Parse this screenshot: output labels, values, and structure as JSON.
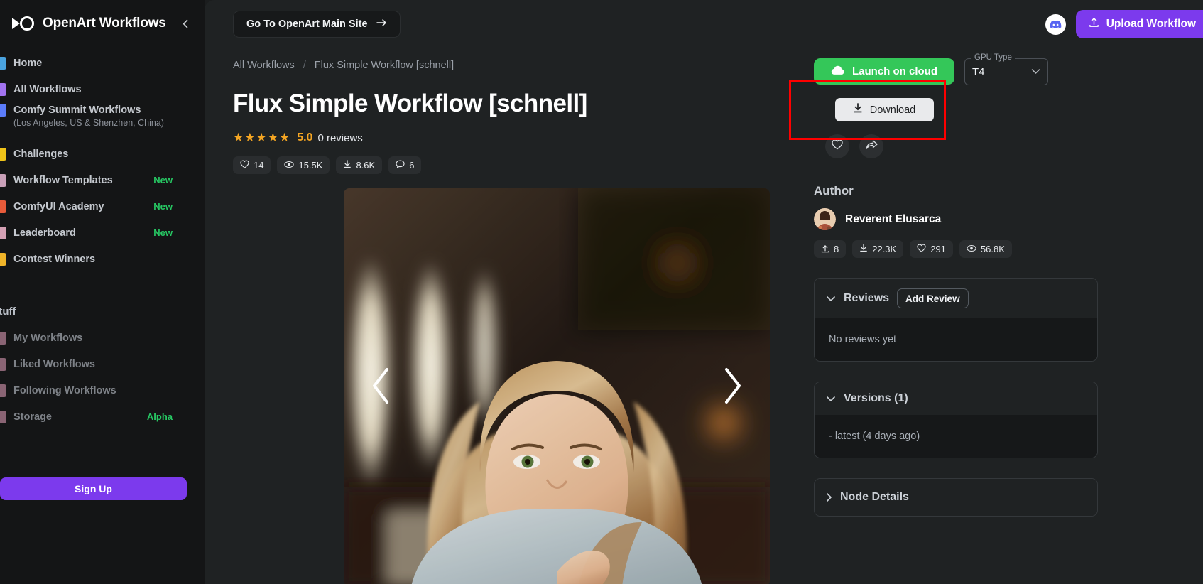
{
  "sidebar": {
    "brand": "OpenArt Workflows",
    "collapse_icon": "chevron-left-icon",
    "items": [
      {
        "label": "Home",
        "badge": "",
        "sub": "",
        "color": "#4aa3df"
      },
      {
        "label": "All Workflows",
        "badge": "",
        "sub": "",
        "color": "#a273f0"
      },
      {
        "label": "Comfy Summit Workflows",
        "sub": "(Los Angeles, US & Shenzhen, China)",
        "badge": "",
        "color": "#5b7cfa"
      },
      {
        "label": "Challenges",
        "badge": "",
        "sub": "",
        "color": "#f0c419"
      },
      {
        "label": "Workflow Templates",
        "badge": "New",
        "sub": "",
        "color": "#c9a0b8"
      },
      {
        "label": "ComfyUI Academy",
        "badge": "New",
        "sub": "",
        "color": "#e85b3a"
      },
      {
        "label": "Leaderboard",
        "badge": "New",
        "sub": "",
        "color": "#d4a0b4"
      },
      {
        "label": "Contest Winners",
        "badge": "",
        "sub": "",
        "color": "#f0b429"
      }
    ],
    "section_label": "stuff",
    "user_items": [
      {
        "label": "My Workflows",
        "badge": "",
        "color": "#b07a8e"
      },
      {
        "label": "Liked Workflows",
        "badge": "",
        "color": "#b07a8e"
      },
      {
        "label": "Following Workflows",
        "badge": "",
        "color": "#b07a8e"
      },
      {
        "label": "Storage",
        "badge": "Alpha",
        "color": "#b07a8e"
      }
    ],
    "signup_label": "Sign Up"
  },
  "topbar": {
    "goto_label": "Go To OpenArt Main Site",
    "goto_arrow": "arrow-right-icon",
    "discord_icon": "discord-icon",
    "upload_label": "Upload Workflow",
    "upload_icon": "upload-icon"
  },
  "breadcrumb": {
    "root": "All Workflows",
    "separator": "/",
    "current": "Flux Simple Workflow [schnell]"
  },
  "workflow": {
    "title": "Flux Simple Workflow [schnell]",
    "rating_stars": "★★★★★",
    "rating_value": "5.0",
    "reviews_label": "0 reviews",
    "stats": [
      {
        "icon": "heart-icon",
        "value": "14"
      },
      {
        "icon": "eye-icon",
        "value": "15.5K"
      },
      {
        "icon": "download-icon",
        "value": "8.6K"
      },
      {
        "icon": "comment-icon",
        "value": "6"
      }
    ],
    "carousel": {
      "prev_icon": "chevron-left-icon",
      "next_icon": "chevron-right-icon"
    }
  },
  "actions": {
    "launch_label": "Launch on cloud",
    "launch_icon": "cloud-icon",
    "launch_color": "#34c759",
    "gpu_legend": "GPU Type",
    "gpu_value": "T4",
    "gpu_chevron": "chevron-down-icon",
    "download_label": "Download",
    "download_icon": "download-icon",
    "highlight_color": "#ff0000",
    "like_icon": "heart-icon",
    "share_icon": "share-icon"
  },
  "author": {
    "heading": "Author",
    "name": "Reverent Elusarca",
    "avatar": "avatar",
    "stats": [
      {
        "icon": "upload-icon",
        "value": "8"
      },
      {
        "icon": "download-icon",
        "value": "22.3K"
      },
      {
        "icon": "heart-icon",
        "value": "291"
      },
      {
        "icon": "eye-icon",
        "value": "56.8K"
      }
    ]
  },
  "panels": {
    "reviews": {
      "title": "Reviews",
      "chevron": "chevron-down-icon",
      "add_label": "Add Review",
      "empty_text": "No reviews yet"
    },
    "versions": {
      "title": "Versions (1)",
      "chevron": "chevron-down-icon",
      "entry": "- latest (4 days ago)"
    },
    "node_details": {
      "title": "Node Details",
      "chevron": "chevron-right-icon"
    }
  }
}
